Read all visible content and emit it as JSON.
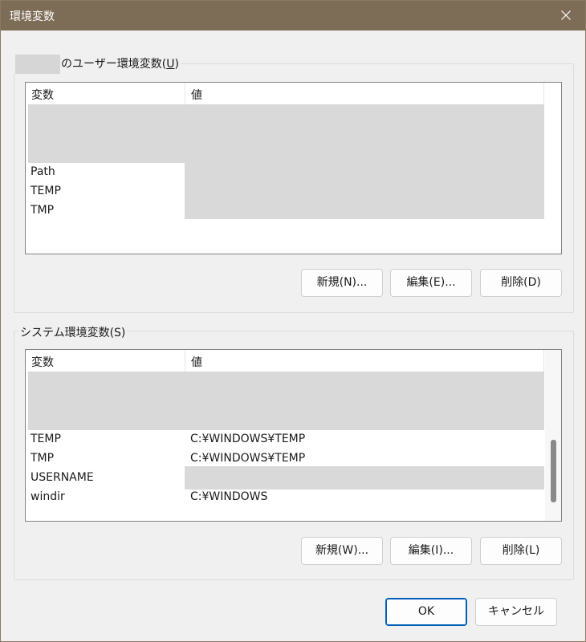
{
  "window": {
    "title": "環境変数"
  },
  "user_vars": {
    "legend_suffix": "のユーザー環境変数(",
    "legend_key": "U",
    "legend_close": ")",
    "col_variable": "変数",
    "col_value": "値",
    "rows": [
      {
        "name": "Path",
        "value": ""
      },
      {
        "name": "TEMP",
        "value": ""
      },
      {
        "name": "TMP",
        "value": ""
      }
    ],
    "buttons": {
      "new": "新規(N)...",
      "edit": "編集(E)...",
      "delete": "削除(D)"
    }
  },
  "system_vars": {
    "legend": "システム環境変数(S)",
    "col_variable": "変数",
    "col_value": "値",
    "rows": [
      {
        "name": "TEMP",
        "value": "C:¥WINDOWS¥TEMP"
      },
      {
        "name": "TMP",
        "value": "C:¥WINDOWS¥TEMP"
      },
      {
        "name": "USERNAME",
        "value": ""
      },
      {
        "name": "windir",
        "value": "C:¥WINDOWS"
      }
    ],
    "buttons": {
      "new": "新規(W)...",
      "edit": "編集(I)...",
      "delete": "削除(L)"
    }
  },
  "footer": {
    "ok": "OK",
    "cancel": "キャンセル"
  }
}
